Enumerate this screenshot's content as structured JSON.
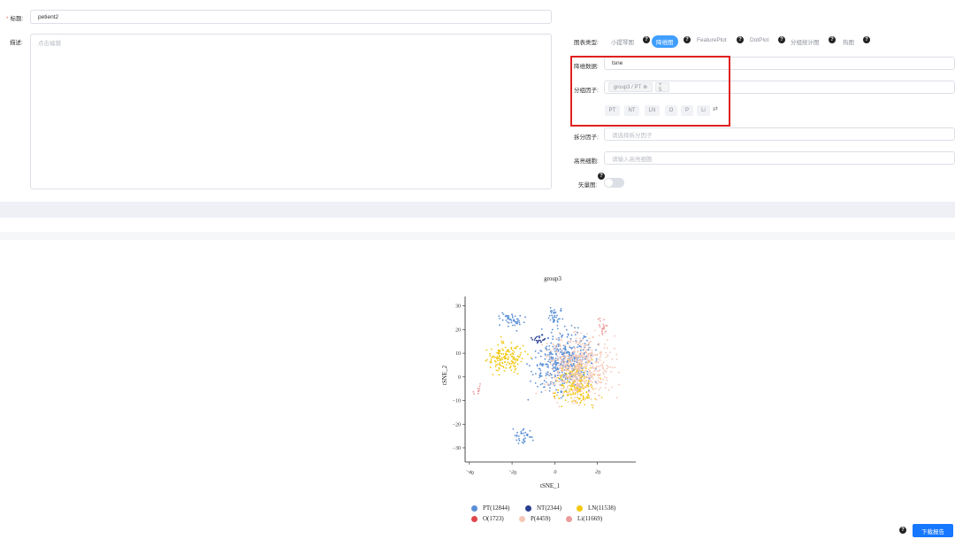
{
  "form": {
    "title_label": "标题:",
    "title_value": "petient2",
    "desc_label": "描述:",
    "desc_placeholder": "点击编辑"
  },
  "settings": {
    "chart_type_label": "图表类型:",
    "chart_types": [
      "小提琴图",
      "降维图",
      "FeaturePlot",
      "DotPlot",
      "分组统计图",
      "热图"
    ],
    "active_chart_type": "降维图",
    "dim_label": "降维数据:",
    "dim_value": "tsne",
    "group_label": "分组因子:",
    "group_tag": "group3 / PT",
    "group_more": "+ 5",
    "group_chips": [
      "PT",
      "NT",
      "LN",
      "O",
      "P",
      "Li"
    ],
    "split_label": "拆分因子:",
    "split_placeholder": "请选择拆分因子",
    "highlight_label": "高亮细胞:",
    "highlight_placeholder": "请输入高亮细胞",
    "vector_label": "矢量图:",
    "vector_on": false
  },
  "chart_data": {
    "type": "scatter",
    "title": "group3",
    "xlabel": "tSNE_1",
    "ylabel": "tSNE_2",
    "xlim": [
      -42,
      38
    ],
    "ylim": [
      -36,
      34
    ],
    "xticks": [
      -40,
      -20,
      0,
      20
    ],
    "yticks": [
      30,
      20,
      10,
      0,
      -10,
      -20,
      -30
    ],
    "legend": [
      {
        "name": "PT(12844)",
        "color": "#5b8fd6"
      },
      {
        "name": "NT(2344)",
        "color": "#2a3f8f"
      },
      {
        "name": "LN(11538)",
        "color": "#f2c811"
      },
      {
        "name": "O(1723)",
        "color": "#e0474c"
      },
      {
        "name": "P(4459)",
        "color": "#f4c7b6"
      },
      {
        "name": "Li(11669)",
        "color": "#ea9b9b"
      }
    ],
    "clusters": [
      {
        "label": "PT",
        "cx": 4,
        "cy": 6,
        "sx": 12,
        "sy": 11
      },
      {
        "label": "LN",
        "cx": 10,
        "cy": -3,
        "sx": 8,
        "sy": 8
      },
      {
        "label": "LN",
        "cx": -23,
        "cy": 8,
        "sx": 8,
        "sy": 6
      },
      {
        "label": "PT",
        "cx": 0,
        "cy": 26,
        "sx": 3,
        "sy": 4
      },
      {
        "label": "PT",
        "cx": -20,
        "cy": 24,
        "sx": 5,
        "sy": 3
      },
      {
        "label": "Li",
        "cx": 22,
        "cy": 21,
        "sx": 2,
        "sy": 3
      },
      {
        "label": "PT",
        "cx": -15,
        "cy": -25,
        "sx": 4,
        "sy": 3
      },
      {
        "label": "Li",
        "cx": -36,
        "cy": -5,
        "sx": 1.5,
        "sy": 2
      },
      {
        "label": "P",
        "cx": 12,
        "cy": 4,
        "sx": 14,
        "sy": 12
      },
      {
        "label": "NT",
        "cx": -8,
        "cy": 16,
        "sx": 3,
        "sy": 2
      }
    ]
  },
  "footer": {
    "download_label": "下载报告"
  }
}
